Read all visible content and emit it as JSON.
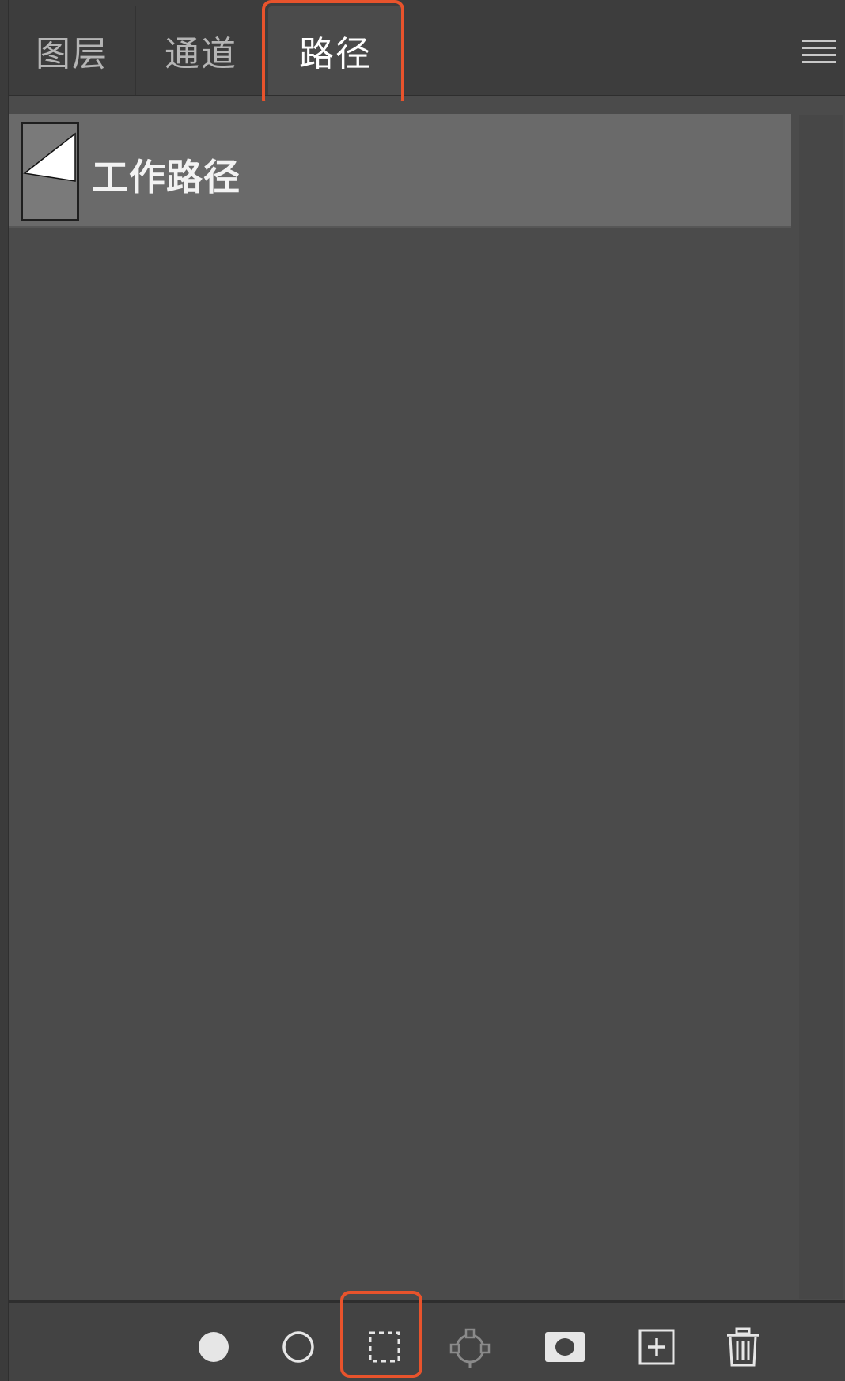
{
  "tabs": [
    {
      "label": "图层",
      "active": false
    },
    {
      "label": "通道",
      "active": false
    },
    {
      "label": "路径",
      "active": true
    }
  ],
  "paths": [
    {
      "name": "工作路径",
      "selected": true
    }
  ],
  "toolbar": {
    "tools": [
      {
        "icon": "fill-path-icon"
      },
      {
        "icon": "stroke-path-icon"
      },
      {
        "icon": "load-path-as-selection-icon"
      },
      {
        "icon": "make-work-path-icon"
      },
      {
        "icon": "add-mask-icon"
      },
      {
        "icon": "new-path-icon"
      },
      {
        "icon": "delete-path-icon"
      }
    ]
  },
  "colors": {
    "panel_bg": "#4b4b4b",
    "tabbar_bg": "#3d3d3d",
    "selected_row": "#6a6a6a",
    "annotation": "#e8532c"
  }
}
